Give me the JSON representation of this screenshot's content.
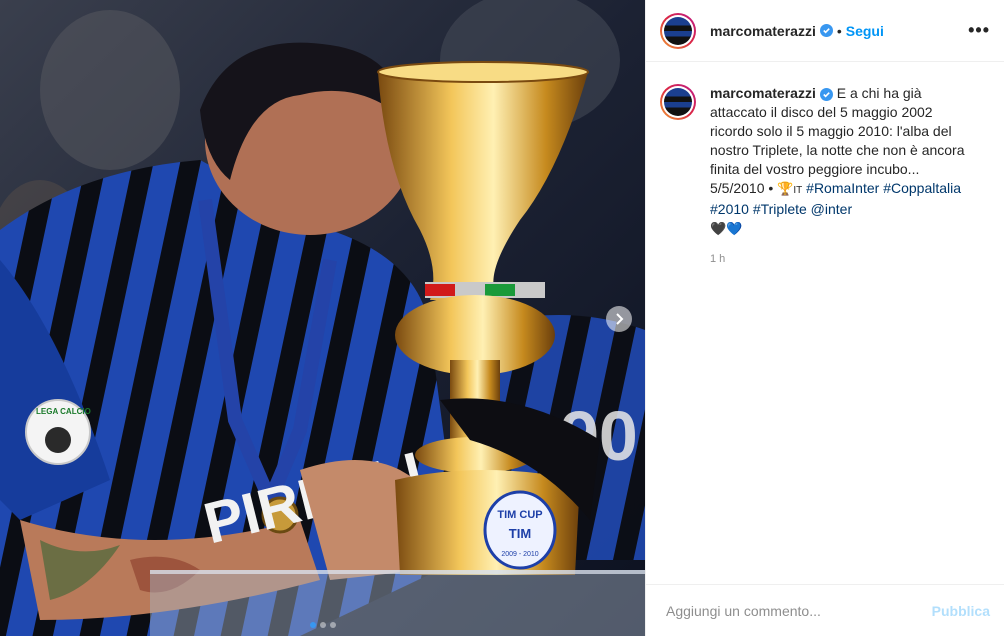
{
  "post": {
    "username": "marcomaterazzi",
    "separator": "•",
    "follow_label": "Segui",
    "more_label": "•••"
  },
  "caption": {
    "username": "marcomaterazzi",
    "text_1": "E a chi ha già attaccato il disco del 5 maggio 2002 ricordo solo il 5 maggio 2010: l'alba del nostro Triplete, la notte che non è ancora finita del vostro peggiore incubo... 5/5/2010 •",
    "trophy_emoji": "🏆",
    "it_text": "IT",
    "hashtags": [
      "#RomaInter",
      "#Coppaltalia",
      "#2010",
      "#Triplete"
    ],
    "mention": "@inter",
    "hearts": [
      "🖤",
      "💙"
    ],
    "time": "1 h"
  },
  "comment": {
    "placeholder": "Aggiungi un commento...",
    "publish_label": "Pubblica"
  },
  "media": {
    "photo_text": {
      "sponsor": "PIRELLI",
      "cup_label_top": "TIM CUP",
      "cup_label_mid": "TIM",
      "cup_label_years": "2009 - 2010",
      "patch_text": "LEGA CALCIO",
      "patch_sub": "TIM CUP",
      "lanyard": "TIM"
    },
    "carousel_count": 3,
    "carousel_active": 0
  }
}
